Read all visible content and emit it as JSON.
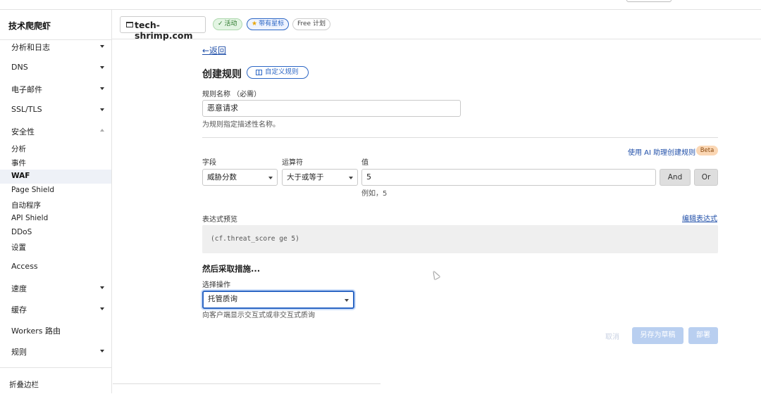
{
  "sidebar": {
    "account_name": "技术爬爬虾",
    "items": [
      {
        "label": "分析和日志",
        "caret": "down"
      },
      {
        "label": "DNS",
        "caret": "down"
      },
      {
        "label": "电子邮件",
        "caret": "down"
      },
      {
        "label": "SSL/TLS",
        "caret": "down"
      },
      {
        "label": "安全性",
        "caret": "up"
      },
      {
        "label": "分析"
      },
      {
        "label": "事件"
      },
      {
        "label": "WAF",
        "active": true
      },
      {
        "label": "Page Shield"
      },
      {
        "label": "自动程序"
      },
      {
        "label": "API Shield"
      },
      {
        "label": "DDoS"
      },
      {
        "label": "设置"
      },
      {
        "label": "Access"
      },
      {
        "label": "速度",
        "caret": "down"
      },
      {
        "label": "缓存",
        "caret": "down"
      },
      {
        "label": "Workers 路由"
      },
      {
        "label": "规则",
        "caret": "down"
      }
    ],
    "collapse_label": "折叠边栏"
  },
  "header": {
    "domain": "tech-shrimp.com",
    "badge_active": "活动",
    "badge_starred": "带有星标",
    "badge_plan": "Free 计划"
  },
  "form": {
    "back_label": "←返回",
    "title": "创建规则",
    "custom_rule_label": "自定义规则",
    "rule_name_label": "规则名称 （必需）",
    "rule_name_value": "恶意请求",
    "rule_name_help": "为规则指定描述性名称。",
    "ai_link": "使用 AI 助理创建规则",
    "beta": "Beta",
    "field_label": "字段",
    "operator_label": "运算符",
    "value_label": "值",
    "field_value": "威胁分数",
    "operator_value": "大于或等于",
    "value_value": "5",
    "value_example": "例如，5",
    "and_label": "And",
    "or_label": "Or",
    "expression_preview_label": "表达式预览",
    "edit_expression_label": "编辑表达式",
    "expression": "(cf.threat_score ge 5)",
    "then_action_title": "然后采取措施...",
    "choose_action_label": "选择操作",
    "action_value": "托管质询",
    "action_help": "向客户端显示交互式或非交互式质询",
    "cancel_label": "取消",
    "save_draft_label": "另存为草稿",
    "deploy_label": "部署"
  },
  "colors": {
    "link": "#1f4ea8",
    "accent": "#2c66c4",
    "beta_bg": "#fbd7b4",
    "primary_disabled": "#b9cff0"
  }
}
